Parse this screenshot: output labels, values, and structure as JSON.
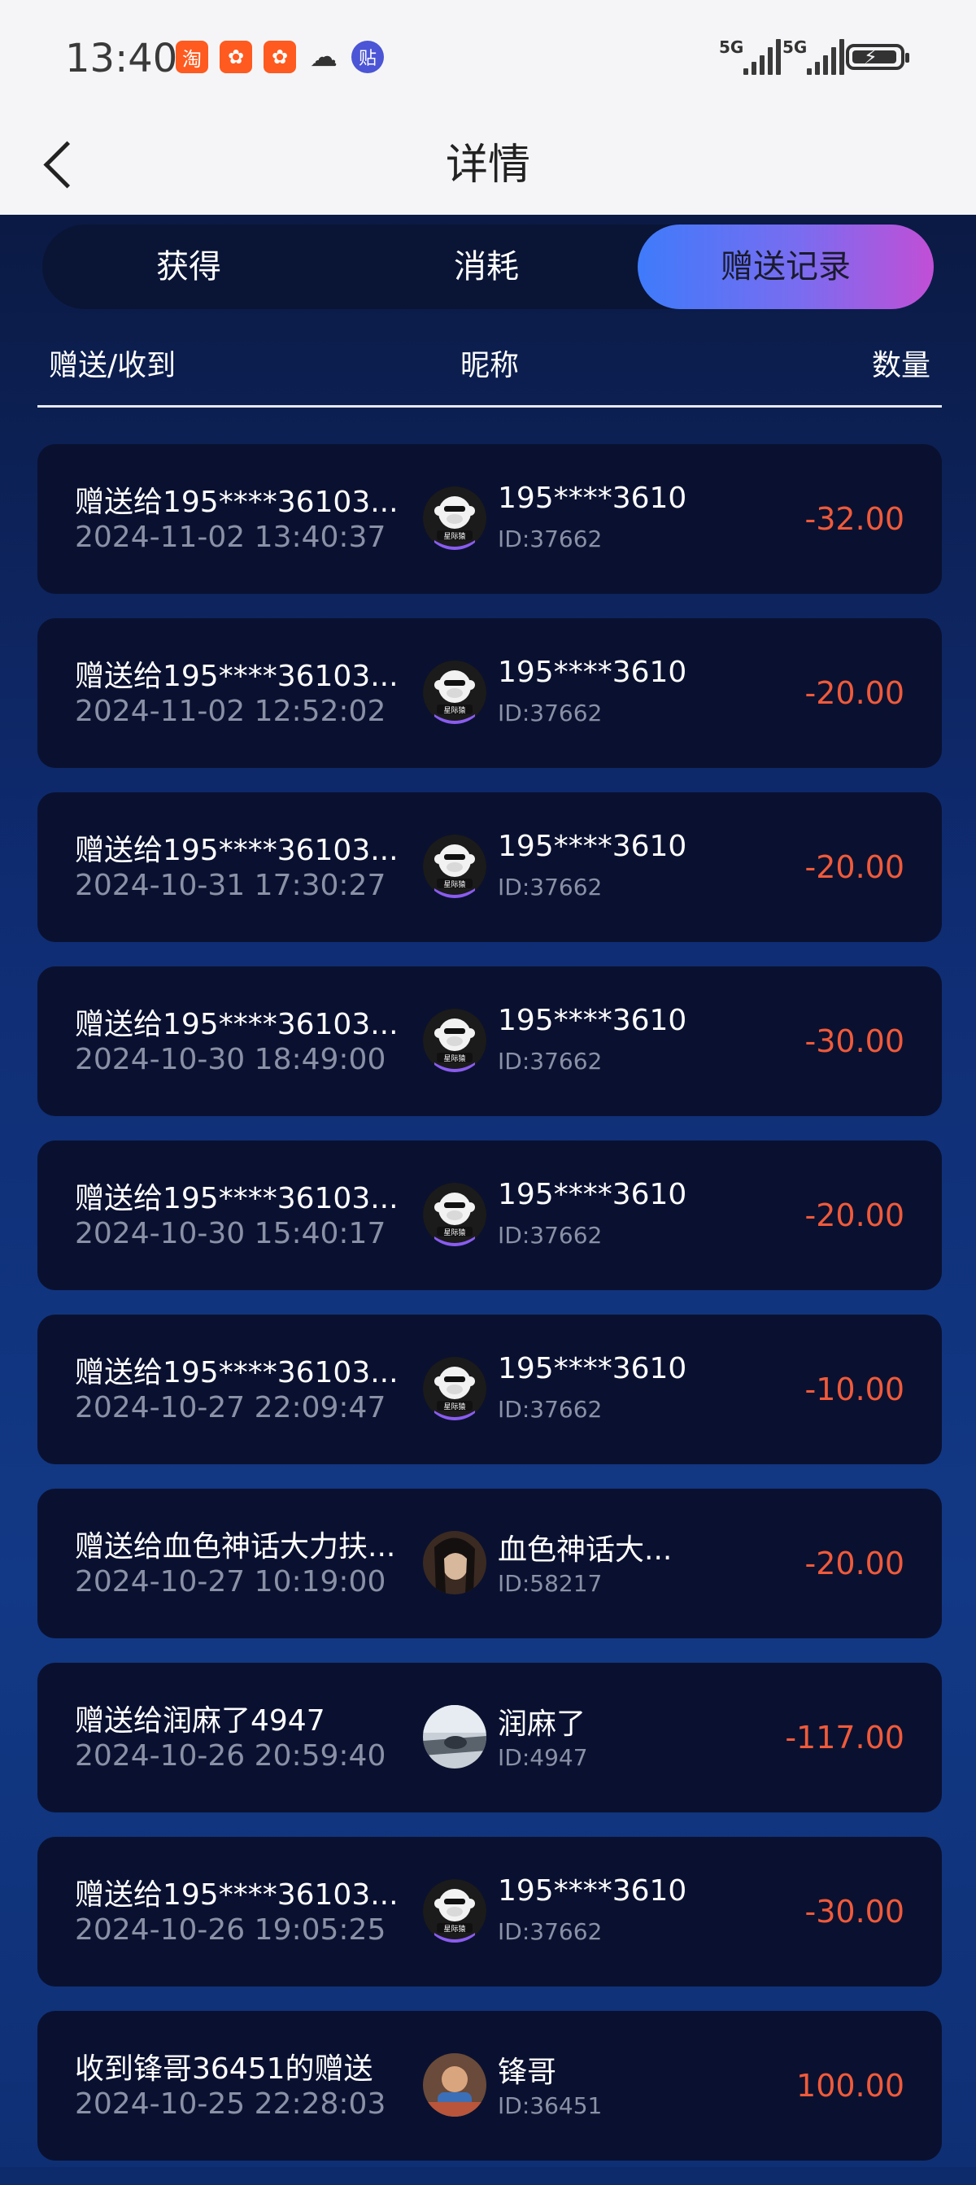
{
  "status_bar": {
    "time": "13:40",
    "apps": [
      {
        "name": "taobao-icon",
        "glyph": "淘",
        "class": "ico-taobao"
      },
      {
        "name": "kuaishou-icon",
        "glyph": "✿",
        "class": "ico-kuai"
      },
      {
        "name": "kuaishou-icon-2",
        "glyph": "✿",
        "class": "ico-kuai"
      },
      {
        "name": "wechat-icon",
        "glyph": "☁",
        "class": "ico-wechat"
      },
      {
        "name": "tieba-icon",
        "glyph": "贴",
        "class": "ico-tie"
      }
    ],
    "signal_1_label": "5G",
    "signal_2_label": "5G"
  },
  "nav": {
    "title": "详情"
  },
  "tabs": [
    {
      "label": "获得",
      "active": false
    },
    {
      "label": "消耗",
      "active": false
    },
    {
      "label": "赠送记录",
      "active": true
    }
  ],
  "columns": {
    "left": "赠送/收到",
    "mid": "昵称",
    "right": "数量"
  },
  "colors": {
    "negative": "#f05a3a",
    "positive": "#f05a3a"
  },
  "records": [
    {
      "desc": "赠送给195****36103...",
      "date": "2024-11-02 13:40:37",
      "nick": "195****3610",
      "uid": "ID:37662",
      "amount": "-32.00",
      "avatar": "monkey"
    },
    {
      "desc": "赠送给195****36103...",
      "date": "2024-11-02 12:52:02",
      "nick": "195****3610",
      "uid": "ID:37662",
      "amount": "-20.00",
      "avatar": "monkey"
    },
    {
      "desc": "赠送给195****36103...",
      "date": "2024-10-31 17:30:27",
      "nick": "195****3610",
      "uid": "ID:37662",
      "amount": "-20.00",
      "avatar": "monkey"
    },
    {
      "desc": "赠送给195****36103...",
      "date": "2024-10-30 18:49:00",
      "nick": "195****3610",
      "uid": "ID:37662",
      "amount": "-30.00",
      "avatar": "monkey"
    },
    {
      "desc": "赠送给195****36103...",
      "date": "2024-10-30 15:40:17",
      "nick": "195****3610",
      "uid": "ID:37662",
      "amount": "-20.00",
      "avatar": "monkey"
    },
    {
      "desc": "赠送给195****36103...",
      "date": "2024-10-27 22:09:47",
      "nick": "195****3610",
      "uid": "ID:37662",
      "amount": "-10.00",
      "avatar": "monkey"
    },
    {
      "desc": "赠送给血色神话大力扶...",
      "date": "2024-10-27 10:19:00",
      "nick": "血色神话大...",
      "uid": "ID:58217",
      "amount": "-20.00",
      "avatar": "photo-woman"
    },
    {
      "desc": "赠送给润麻了4947",
      "date": "2024-10-26 20:59:40",
      "nick": "润麻了",
      "uid": "ID:4947",
      "amount": "-117.00",
      "avatar": "photo-road"
    },
    {
      "desc": "赠送给195****36103...",
      "date": "2024-10-26 19:05:25",
      "nick": "195****3610",
      "uid": "ID:37662",
      "amount": "-30.00",
      "avatar": "monkey"
    },
    {
      "desc": "收到锋哥36451的赠送",
      "date": "2024-10-25 22:28:03",
      "nick": "锋哥",
      "uid": "ID:36451",
      "amount": "100.00",
      "avatar": "photo-kid"
    }
  ],
  "monkey_logo_text": "星际猿"
}
